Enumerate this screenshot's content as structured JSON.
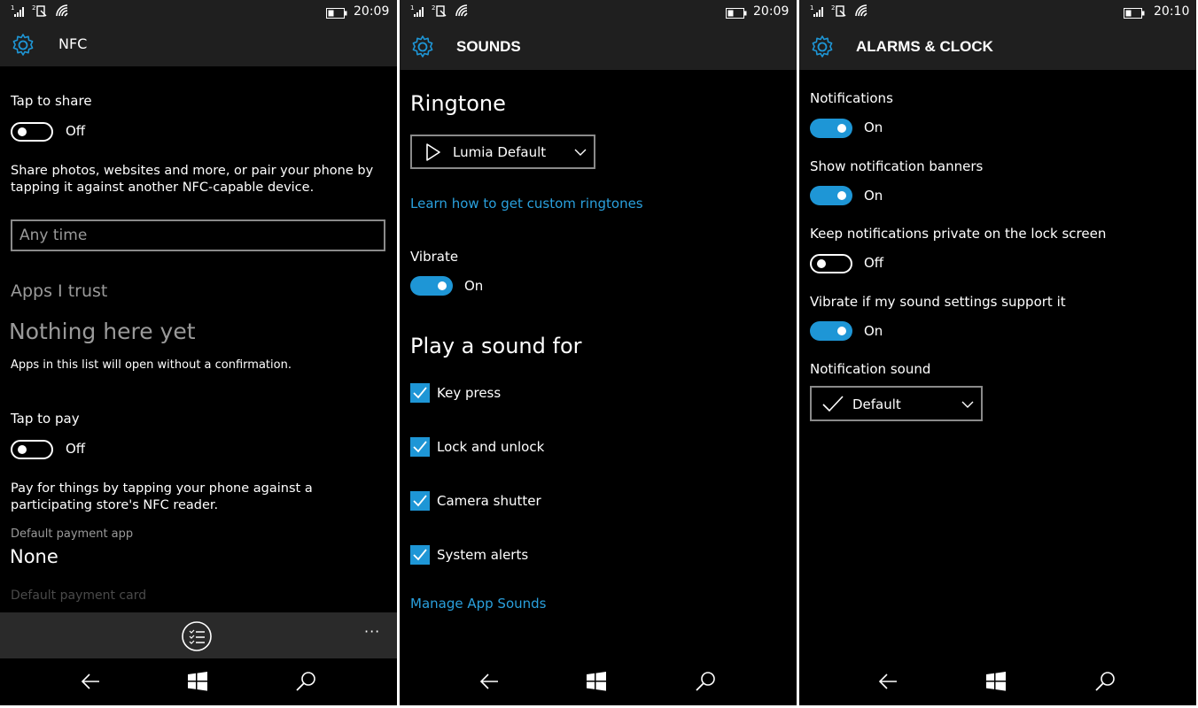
{
  "colors": {
    "accent": "#1e96d6",
    "link": "#2aa0dd",
    "background": "#000000",
    "header": "#1f1f1f"
  },
  "screens": [
    {
      "time": "20:09",
      "title": "NFC",
      "tap_to_share": {
        "label": "Tap to share",
        "state": "Off"
      },
      "share_description_1": "Share photos, websites and more, or pair your phone by",
      "share_description_2": "tapping it against another NFC-capable device.",
      "share_input_placeholder": "Any time",
      "apps_trust_heading": "Apps I trust",
      "empty_heading": "Nothing here yet",
      "empty_description": "Apps in this list will open without a confirmation.",
      "tap_to_pay": {
        "label": "Tap to pay",
        "state": "Off"
      },
      "pay_description_1": "Pay for things by tapping your phone against a",
      "pay_description_2": "participating store's NFC reader.",
      "default_payment_app_label": "Default payment app",
      "default_payment_app_value": "None",
      "default_payment_card_label": "Default payment card",
      "more_label": "···"
    },
    {
      "time": "20:09",
      "title": "SOUNDS",
      "ringtone_heading": "Ringtone",
      "ringtone_value": "Lumia Default",
      "custom_ringtones_link": "Learn how to get custom ringtones",
      "vibrate": {
        "label": "Vibrate",
        "state": "On"
      },
      "play_sound_heading": "Play a sound for",
      "checkboxes": [
        {
          "label": "Key press",
          "checked": true
        },
        {
          "label": "Lock and unlock",
          "checked": true
        },
        {
          "label": "Camera shutter",
          "checked": true
        },
        {
          "label": "System alerts",
          "checked": true
        }
      ],
      "manage_link": "Manage App Sounds"
    },
    {
      "time": "20:10",
      "title": "ALARMS & CLOCK",
      "toggles": [
        {
          "label": "Notifications",
          "state": "On"
        },
        {
          "label": "Show notification banners",
          "state": "On"
        },
        {
          "label": "Keep notifications private on the lock screen",
          "state": "Off"
        },
        {
          "label": "Vibrate if my sound settings support it",
          "state": "On"
        }
      ],
      "notification_sound_label": "Notification sound",
      "notification_sound_value": "Default"
    }
  ]
}
